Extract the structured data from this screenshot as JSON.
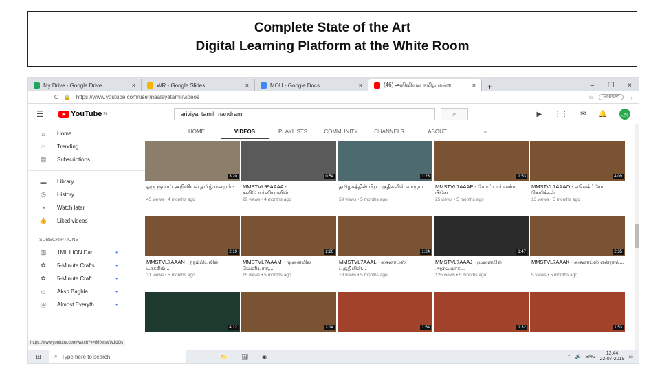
{
  "slide": {
    "line1": "Complete State of the Art",
    "line2": "Digital Learning Platform at the White Room"
  },
  "browser": {
    "tabs": [
      {
        "label": "My Drive - Google Drive",
        "color": "#1fa463"
      },
      {
        "label": "WR - Google Slides",
        "color": "#f4b400"
      },
      {
        "label": "MOU - Google Docs",
        "color": "#4285f4"
      },
      {
        "label": "(46) அறிவியல் தமிழ் மன்ற",
        "color": "#ff0000"
      }
    ],
    "tab_close": "×",
    "new_tab": "+",
    "min": "–",
    "max": "❐",
    "close": "×",
    "url": "https://www.youtube.com/user/naalayatamil/videos",
    "paused": "Paused"
  },
  "yt": {
    "logo": "YouTube",
    "logo_sup": "IN",
    "search_value": "ariviyal tamil mandram",
    "search_icon": "⌕",
    "nav": [
      "HOME",
      "VIDEOS",
      "PLAYLISTS",
      "COMMUNITY",
      "CHANNELS",
      "ABOUT"
    ],
    "avatar": "அ",
    "sidebar": {
      "main": [
        {
          "icon": "⌂",
          "label": "Home"
        },
        {
          "icon": "♨",
          "label": "Trending"
        },
        {
          "icon": "▤",
          "label": "Subscriptions"
        }
      ],
      "lib": [
        {
          "icon": "▬",
          "label": "Library"
        },
        {
          "icon": "◷",
          "label": "History"
        },
        {
          "icon": "◔",
          "label": "Watch later"
        },
        {
          "icon": "👍",
          "label": "Liked videos"
        }
      ],
      "subs_head": "SUBSCRIPTIONS",
      "subs": [
        {
          "icon": "▥",
          "label": "1MILLION Dan...",
          "dot": "•"
        },
        {
          "icon": "✿",
          "label": "5-Minute Crafts",
          "dot": "•"
        },
        {
          "icon": "✿",
          "label": "5-Minute Craft...",
          "dot": "•"
        },
        {
          "icon": "☺",
          "label": "Aksh Baghla",
          "dot": "•"
        },
        {
          "icon": "Ⓐ",
          "label": "Almost Everyth...",
          "dot": "•"
        }
      ]
    },
    "videos": [
      [
        {
          "dur": "3:20",
          "title": "ஒரு ரூபாய் அறிவியல் தமிழ் மன்றம் -...",
          "meta": "45 views • 4 months ago",
          "bg": "#8c7e6a"
        },
        {
          "dur": "0:54",
          "title": "MMSTVL99AAAA - கவிபோர்னியாவில்...",
          "meta": "29 views • 4 months ago",
          "bg": "#5a5a5a"
        },
        {
          "dur": "1:23",
          "title": "தமிழகத்தின் பிற பகுதிகளில் வாழும்...",
          "meta": "59 views • 5 months ago",
          "bg": "#4d6a6e"
        },
        {
          "dur": "1:53",
          "title": "MMSTVL7AAAP - மோட்டார் எண்ட் பிளே...",
          "meta": "25 views • 5 months ago",
          "bg": "#7a5333"
        },
        {
          "dur": "4:09",
          "title": "MMSTVL7AAAO - எலெக்ட்ரோ கெமிக்கல்...",
          "meta": "13 views • 5 months ago",
          "bg": "#7a5333"
        }
      ],
      [
        {
          "dur": "2:19",
          "title": "MMSTVL7AAAN - நரம்பியலில் டாக்கிங்...",
          "meta": "31 views • 5 months ago",
          "bg": "#7a5333"
        },
        {
          "dur": "2:20",
          "title": "MMSTVL7AAAM - மூளையில் வெளியாகு...",
          "meta": "15 views • 5 months ago",
          "bg": "#7a5333"
        },
        {
          "dur": "1:24",
          "title": "MMSTVL7AAAL - சைனாப்ஸ் பகுதியின்...",
          "meta": "18 views • 5 months ago",
          "bg": "#7a5333"
        },
        {
          "dur": "1:47",
          "title": "MMSTVL7AAAJ - மூளையில் அகுவமாக...",
          "meta": "125 views • 5 months ago",
          "bg": "#2b2b2b"
        },
        {
          "dur": "2:35",
          "title": "MMSTVL7AAAK - சைனாப்ஸ் என்றால்...",
          "meta": "5 views • 5 months ago",
          "bg": "#7a5333"
        }
      ],
      [
        {
          "dur": "4:12",
          "title": "",
          "meta": "",
          "bg": "#1e3a2e"
        },
        {
          "dur": "2:14",
          "title": "",
          "meta": "",
          "bg": "#7a5333"
        },
        {
          "dur": "1:54",
          "title": "",
          "meta": "",
          "bg": "#a0432a"
        },
        {
          "dur": "1:32",
          "title": "",
          "meta": "",
          "bg": "#a0432a"
        },
        {
          "dur": "1:53",
          "title": "",
          "meta": "",
          "bg": "#a0432a"
        }
      ]
    ]
  },
  "status_url": "https://www.youtube.com/watch?v=tM0wsVW1dOs",
  "taskbar": {
    "search": "Type here to search",
    "lang": "ENG",
    "time": "12:44",
    "date": "22-07-2019"
  }
}
